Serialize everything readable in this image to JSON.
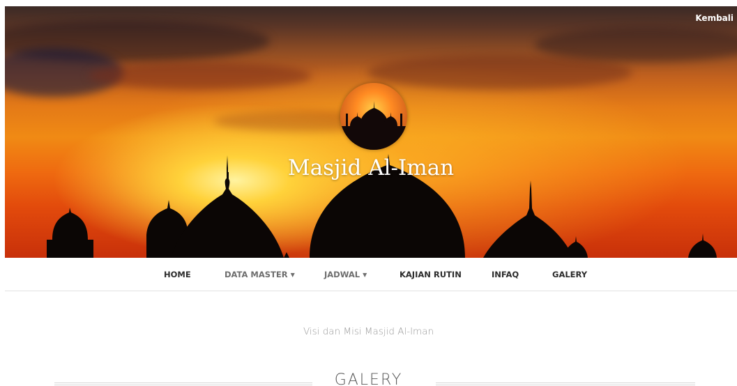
{
  "header": {
    "back_label": "Kembali",
    "site_title": "Masjid Al-Iman"
  },
  "nav": {
    "items": [
      {
        "label": "HOME",
        "has_caret": false
      },
      {
        "label": "DATA MASTER",
        "has_caret": true
      },
      {
        "label": "JADWAL",
        "has_caret": true
      },
      {
        "label": "KAJIAN RUTIN",
        "has_caret": false
      },
      {
        "label": "INFAQ",
        "has_caret": false
      },
      {
        "label": "GALERY",
        "has_caret": false
      }
    ],
    "caret_icon": "caret-down-icon"
  },
  "main": {
    "tagline": "Visi dan Misi Masjid Al-Iman",
    "section_heading": "GALERY"
  },
  "colors": {
    "nav_text": "#2b2b2b",
    "nav_text_dropdown": "#6d6d6d",
    "tagline": "#9a9a9a",
    "heading": "#555555",
    "hero_accent": "#f08a14"
  }
}
